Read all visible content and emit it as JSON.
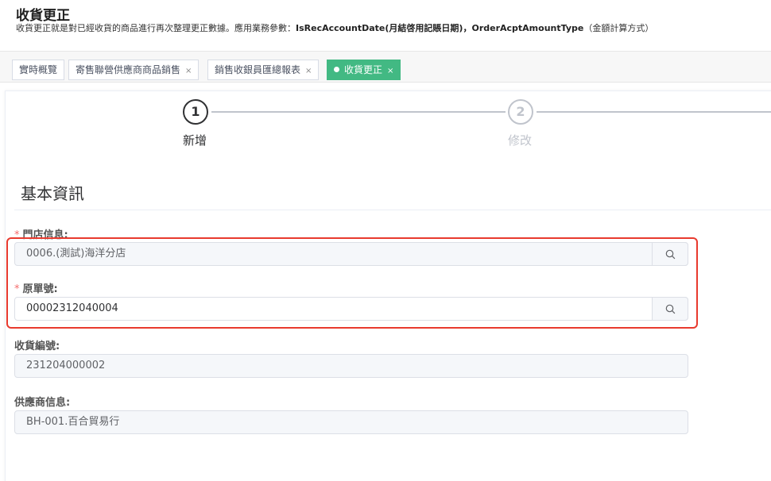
{
  "header": {
    "title": "收貨更正",
    "desc_prefix": "收貨更正就是對已經收貨的商品進行再次整理更正數據。應用業務參數：",
    "param1": "IsRecAccountDate",
    "param1_desc": "(月結啓用記賬日期)，",
    "param2": "OrderAcptAmountType",
    "param2_desc": "（金額計算方式）"
  },
  "tabs": [
    {
      "label": "實時概覽",
      "closable": false
    },
    {
      "label": "寄售聯營供應商商品銷售",
      "closable": true
    },
    {
      "label": "銷售收銀員匯總報表",
      "closable": true
    },
    {
      "label": "收貨更正",
      "closable": true,
      "active": true
    }
  ],
  "tab_close_glyph": "×",
  "steps": [
    {
      "number": "1",
      "label": "新增",
      "status": "active"
    },
    {
      "number": "2",
      "label": "修改",
      "status": "pending"
    }
  ],
  "section_title": "基本資訊",
  "required_mark": "*",
  "fields": {
    "store": {
      "label": "門店信息:",
      "value": "0006.(測試)海洋分店",
      "required": true
    },
    "order_no": {
      "label": "原單號:",
      "value": "00002312040004",
      "required": true
    },
    "receipt_no": {
      "label": "收貨編號:",
      "value": "231204000002"
    },
    "supplier": {
      "label": "供應商信息:",
      "value": "BH-001.百合貿易行"
    }
  },
  "colors": {
    "accent": "#42b983",
    "required": "#f56c6c",
    "highlight": "#e83a2e"
  },
  "icons": {
    "search": "search-icon",
    "close": "close-icon"
  }
}
